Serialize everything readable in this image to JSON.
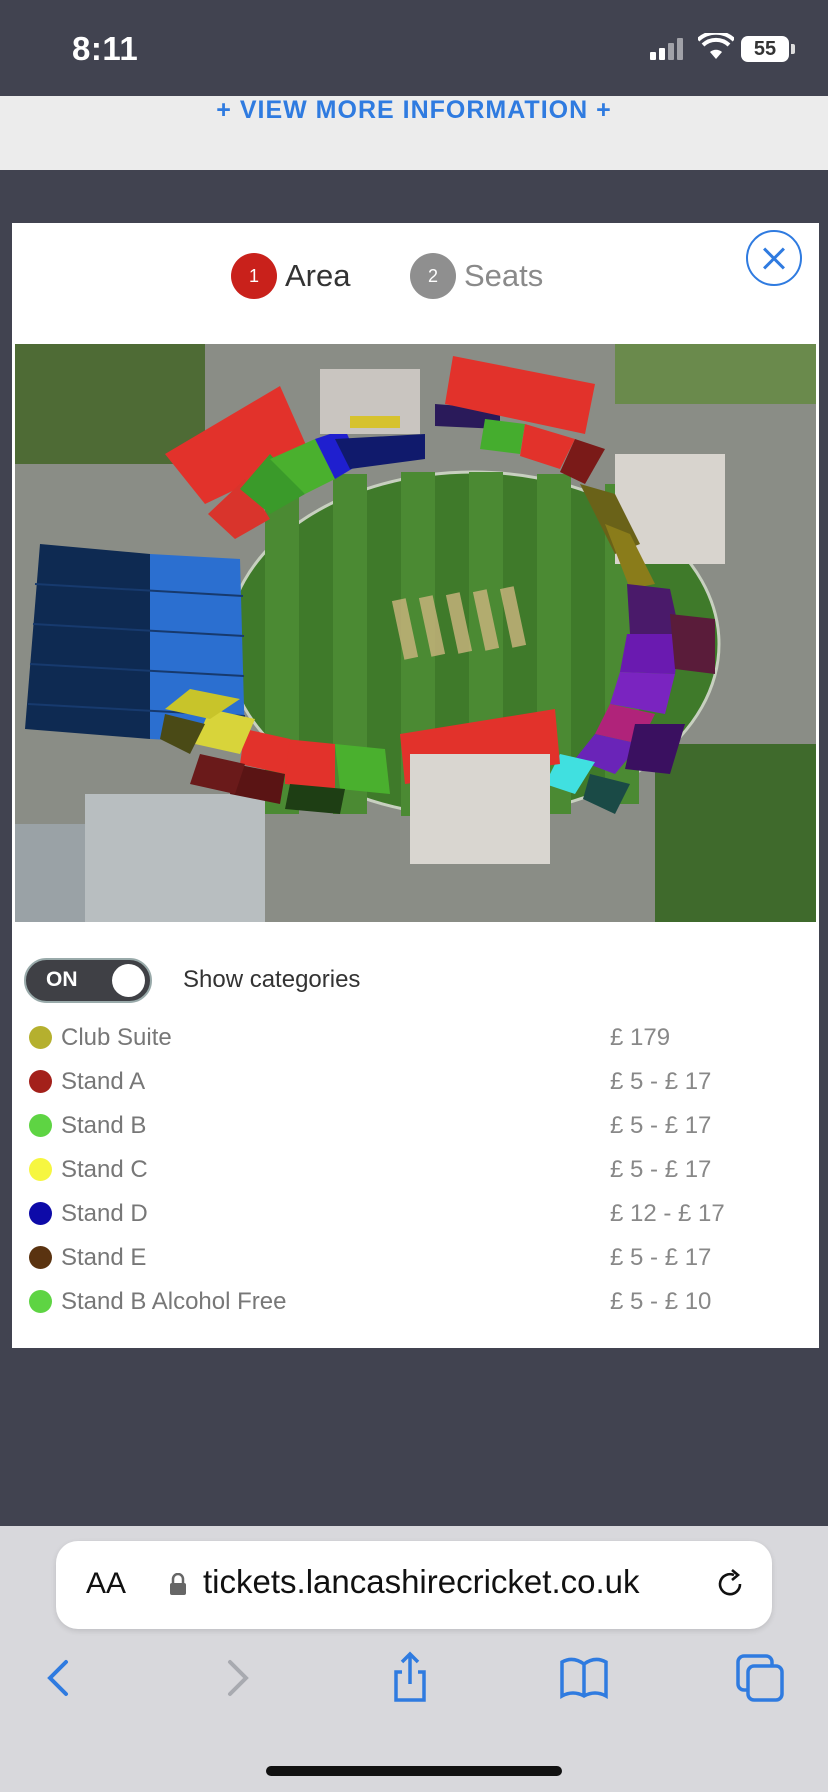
{
  "status_bar": {
    "time": "8:11",
    "battery": "55"
  },
  "info_link": "+ VIEW MORE INFORMATION +",
  "steps": [
    {
      "number": "1",
      "label": "Area",
      "active": true
    },
    {
      "number": "2",
      "label": "Seats",
      "active": false
    }
  ],
  "toggle": {
    "state": "ON",
    "label": "Show categories"
  },
  "categories": [
    {
      "name": "Club Suite",
      "price": "£ 179",
      "color": "#b5b02e"
    },
    {
      "name": "Stand A",
      "price": "£ 5 - £ 17",
      "color": "#a3201a"
    },
    {
      "name": "Stand B",
      "price": "£ 5 - £ 17",
      "color": "#5ed443"
    },
    {
      "name": "Stand C",
      "price": "£ 5 - £ 17",
      "color": "#f6f640"
    },
    {
      "name": "Stand D",
      "price": "£ 12 - £ 17",
      "color": "#0d0aa8"
    },
    {
      "name": "Stand E",
      "price": "£ 5 - £ 17",
      "color": "#5a3310"
    },
    {
      "name": "Stand B Alcohol Free",
      "price": "£ 5 - £ 10",
      "color": "#5ed443"
    }
  ],
  "browser": {
    "text_size_label": "AA",
    "url": "tickets.lancashirecricket.co.uk"
  }
}
